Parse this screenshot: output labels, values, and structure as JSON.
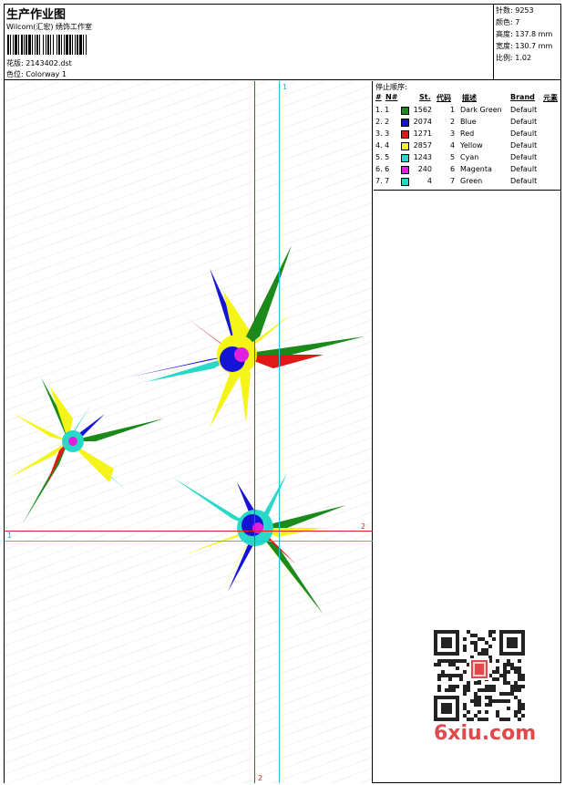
{
  "header": {
    "title": "生产作业图",
    "company": "Wilcom(汇宏) 绣饰工作室",
    "design_label": "花版: 2143402.dst",
    "colorway_label": "色位:  Colorway 1"
  },
  "stats": {
    "stitches": "针数: 9253",
    "colors": "颜色: 7",
    "height": "高度: 137.8 mm",
    "width": "宽度: 130.7 mm",
    "scale": "比例: 1.02"
  },
  "stop_sequence": {
    "title": "停止顺序:",
    "headers": {
      "num": "#",
      "n": "N#",
      "st": "St.",
      "code": "代码",
      "desc": "描述",
      "brand": "Brand",
      "elem": "元素"
    },
    "rows": [
      {
        "num": "1. 1",
        "color": "#1a8a1a",
        "st": "1562",
        "code": "1",
        "desc": "Dark Green",
        "brand": "Default"
      },
      {
        "num": "2. 2",
        "color": "#1414d8",
        "st": "2074",
        "code": "2",
        "desc": "Blue",
        "brand": "Default"
      },
      {
        "num": "3. 3",
        "color": "#e01818",
        "st": "1271",
        "code": "3",
        "desc": "Red",
        "brand": "Default"
      },
      {
        "num": "4. 4",
        "color": "#f4f418",
        "st": "2857",
        "code": "4",
        "desc": "Yellow",
        "brand": "Default"
      },
      {
        "num": "5. 5",
        "color": "#28d8c8",
        "st": "1243",
        "code": "5",
        "desc": "Cyan",
        "brand": "Default"
      },
      {
        "num": "6. 6",
        "color": "#e020e0",
        "st": "240",
        "code": "6",
        "desc": "Magenta",
        "brand": "Default"
      },
      {
        "num": "7. 7",
        "color": "#20d8c0",
        "st": "4",
        "code": "7",
        "desc": "Green",
        "brand": "Default"
      }
    ]
  },
  "guides": {
    "label_1_top": "1",
    "label_1_left": "1",
    "label_2_right": "2",
    "label_2_bottom": "2"
  },
  "watermark": {
    "logo_text": "6xiu.com",
    "seal_text": "刺绣图库"
  },
  "colors": {
    "red_guide": "#e02020",
    "cyan_guide": "#20c8d8"
  }
}
